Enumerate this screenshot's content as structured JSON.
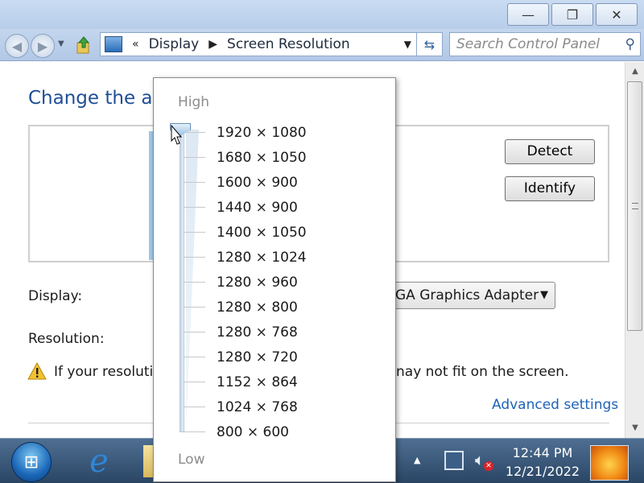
{
  "window": {
    "minimize_glyph": "—",
    "restore_glyph": "❐",
    "close_glyph": "✕"
  },
  "navbar": {
    "back_icon": "back-arrow-icon",
    "forward_icon": "forward-arrow-icon",
    "breadcrumb_prefix": "«",
    "breadcrumb": [
      "Display",
      "Screen Resolution"
    ],
    "search_placeholder": "Search Control Panel"
  },
  "main": {
    "heading": "Change the ap",
    "detect_label": "Detect",
    "identify_label": "Identify",
    "display_label": "Display:",
    "display_value": "GA Graphics Adapter",
    "resolution_label": "Resolution:",
    "warning_text_left": "If your resolutic",
    "warning_text_right": "nay not fit on the screen.",
    "advanced_link": "Advanced settings"
  },
  "resolution_slider": {
    "high_label": "High",
    "low_label": "Low",
    "options": [
      "1920 × 1080",
      "1680 × 1050",
      "1600 × 900",
      "1440 × 900",
      "1400 × 1050",
      "1280 × 1024",
      "1280 × 960",
      "1280 × 800",
      "1280 × 768",
      "1280 × 720",
      "1152 × 864",
      "1024 × 768",
      "800 × 600"
    ],
    "selected": "1920 × 1080"
  },
  "taskbar": {
    "time": "12:44 PM",
    "date": "12/21/2022"
  },
  "colors": {
    "heading": "#1f4e96",
    "link": "#1e63b6",
    "taskbar": "#2a4564"
  }
}
